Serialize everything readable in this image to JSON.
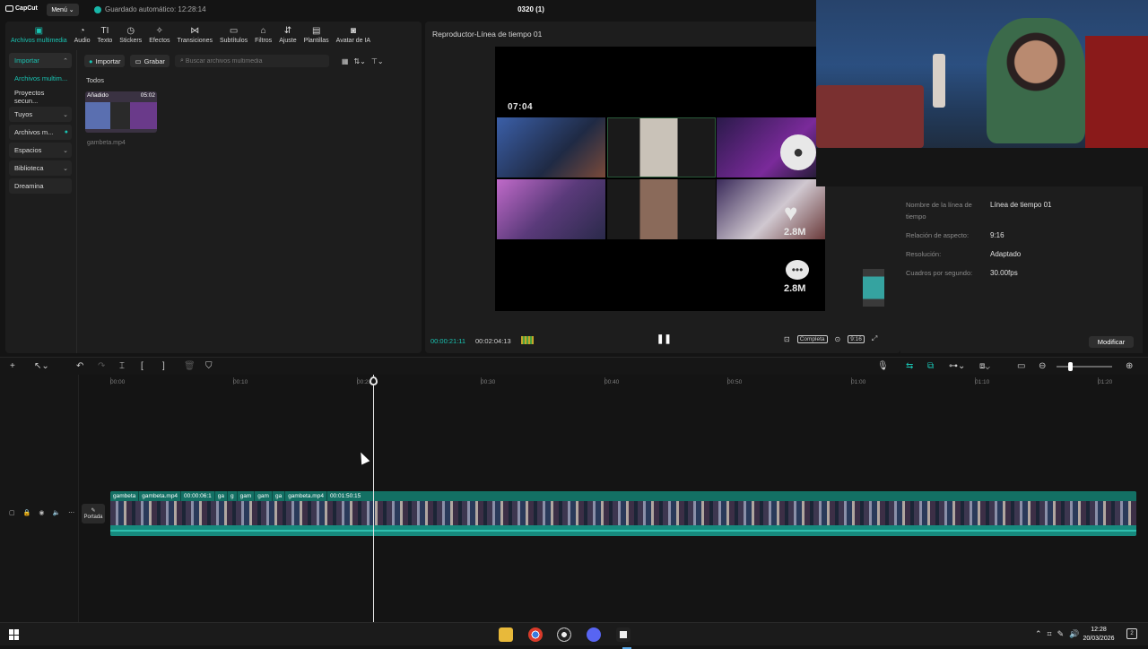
{
  "app": {
    "logo_text": "CapCut",
    "menu_label": "Menú",
    "autosave_text": "Guardado automático: 12:28:14",
    "project_title": "0320 (1)"
  },
  "toolbar": {
    "tabs": [
      {
        "label": "Archivos multimedia",
        "icon": "media-icon",
        "active": true
      },
      {
        "label": "Audio",
        "icon": "audio-icon"
      },
      {
        "label": "Texto",
        "icon": "text-icon"
      },
      {
        "label": "Stickers",
        "icon": "sticker-icon"
      },
      {
        "label": "Efectos",
        "icon": "effects-icon"
      },
      {
        "label": "Transiciones",
        "icon": "transition-icon"
      },
      {
        "label": "Subtítulos",
        "icon": "subtitle-icon"
      },
      {
        "label": "Filtros",
        "icon": "filter-icon"
      },
      {
        "label": "Ajuste",
        "icon": "adjust-icon"
      },
      {
        "label": "Plantillas",
        "icon": "template-icon"
      },
      {
        "label": "Avatar de IA",
        "icon": "ai-avatar-icon"
      }
    ]
  },
  "sidebar": {
    "items": [
      {
        "label": "Importar"
      },
      {
        "label": "Archivos multim..."
      },
      {
        "label": "Proyectos secun..."
      },
      {
        "label": "Tuyos"
      },
      {
        "label": "Archivos m..."
      },
      {
        "label": "Espacios"
      },
      {
        "label": "Biblioteca"
      },
      {
        "label": "Dreamina"
      }
    ]
  },
  "media": {
    "import_label": "Importar",
    "record_label": "Grabar",
    "search_placeholder": "Buscar archivos multimedia",
    "filter_all": "Todos",
    "thumb_added": "Añadido",
    "thumb_duration": "05:02",
    "thumb_name": "gambeta.mp4"
  },
  "player": {
    "title": "Reproductor-Línea de tiempo 01",
    "video_time": "07:04",
    "likes": "2.8M",
    "comments": "2.8M",
    "current_time": "00:00:21:11",
    "total_time": "00:02:04:13",
    "full_label": "Completa",
    "ratio_label": "9:16"
  },
  "properties": {
    "rows": [
      {
        "label": "Nombre de la línea de tiempo",
        "value": "Línea de tiempo 01"
      },
      {
        "label": "Relación de aspecto:",
        "value": "9:16"
      },
      {
        "label": "Resolución:",
        "value": "Adaptado"
      },
      {
        "label": "Cuadros por segundo:",
        "value": "30.00fps"
      }
    ],
    "modify_label": "Modificar"
  },
  "timeline": {
    "ticks": [
      "00:00",
      "00:10",
      "00:20",
      "00:30",
      "00:40",
      "00:50",
      "01:00",
      "01:10",
      "01:20"
    ],
    "cover_label": "Portada",
    "clip_labels": [
      "gambeta",
      "gambeta.mp4",
      "00:00:06:1",
      "ga",
      "g",
      "gam",
      "gam",
      "ga",
      "gambeta.mp4",
      "00:01:50:15"
    ],
    "playhead_fraction": 0.255
  },
  "taskbar": {
    "time": "12:28",
    "date": "20/03/2026",
    "apps": [
      "file-explorer-icon",
      "chrome-icon",
      "obs-icon",
      "discord-icon",
      "capcut-icon"
    ]
  },
  "colors": {
    "accent": "#19c3b2",
    "track": "#0f5a52",
    "panel": "#1d1d1d"
  }
}
